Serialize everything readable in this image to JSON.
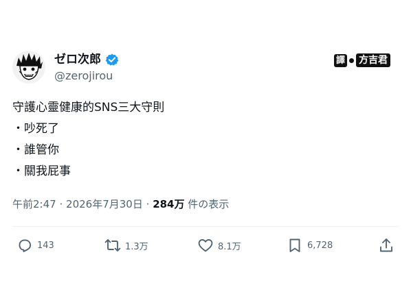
{
  "author": {
    "display_name": "ゼロ次郎",
    "handle": "@zerojirou",
    "avatar": "manga-face-avatar",
    "verified_icon": "verified-check-icon",
    "verified_color": "#1d9bf0"
  },
  "translator_badge": {
    "key": "譯",
    "name": "方吉君"
  },
  "tweet": {
    "lines": [
      "守護心靈健康的SNS三大守則",
      "・吵死了",
      "・誰管你",
      "・關我屁事"
    ]
  },
  "meta": {
    "time": "午前2:47",
    "separator1": "·",
    "date": "2026年7月30日",
    "separator2": "·",
    "views_count": "284万",
    "views_label": "件の表示"
  },
  "actions": {
    "reply": {
      "icon": "reply-icon",
      "count": "143"
    },
    "retweet": {
      "icon": "retweet-icon",
      "count": "1.3万"
    },
    "like": {
      "icon": "heart-icon",
      "count": "8.1万"
    },
    "bookmark": {
      "icon": "bookmark-icon",
      "count": "6,728"
    },
    "share": {
      "icon": "share-icon"
    }
  },
  "colors": {
    "text_primary": "#0f1419",
    "text_secondary": "#536471",
    "divider": "#eff3f4",
    "accent": "#1d9bf0"
  }
}
